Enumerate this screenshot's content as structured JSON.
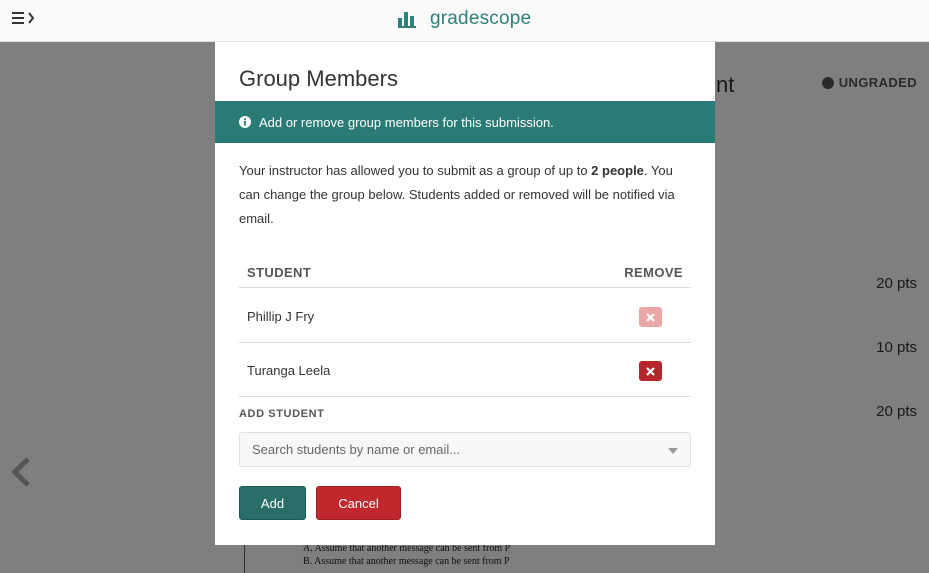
{
  "header": {
    "logo_text": "gradescope",
    "brand_color": "#2f7f7a"
  },
  "background": {
    "title_fragment": "nt",
    "status": "UNGRADED",
    "points": [
      "20 pts",
      "10 pts",
      "20 pts"
    ],
    "pdf_lines": [
      "A.  Assume that another message can be sent from P",
      "B.  Assume that another message can be sent from P"
    ]
  },
  "modal": {
    "title": "Group Members",
    "info": "Add or remove group members for this submission.",
    "desc_before": "Your instructor has allowed you to submit as a group of up to ",
    "desc_bold": "2 people",
    "desc_after": ". You can change the group below. Students added or removed will be notified via email.",
    "table": {
      "col_student": "STUDENT",
      "col_remove": "REMOVE",
      "rows": [
        {
          "name": "Phillip J Fry",
          "removable": false
        },
        {
          "name": "Turanga Leela",
          "removable": true
        }
      ]
    },
    "add_student_label": "ADD STUDENT",
    "search_placeholder": "Search students by name or email...",
    "add_button": "Add",
    "cancel_button": "Cancel"
  },
  "colors": {
    "info_bar": "#2a7b76",
    "remove_active": "#b4262c",
    "remove_disabled": "#e9a7a7",
    "add_button": "#2a6e6a",
    "cancel_button": "#c0282e"
  },
  "icons": {
    "nav": "hamburger-chevron-icon",
    "logo": "bar-chart-icon",
    "info": "info-circle-icon",
    "remove": "close-icon",
    "prev": "chevron-left-icon"
  }
}
